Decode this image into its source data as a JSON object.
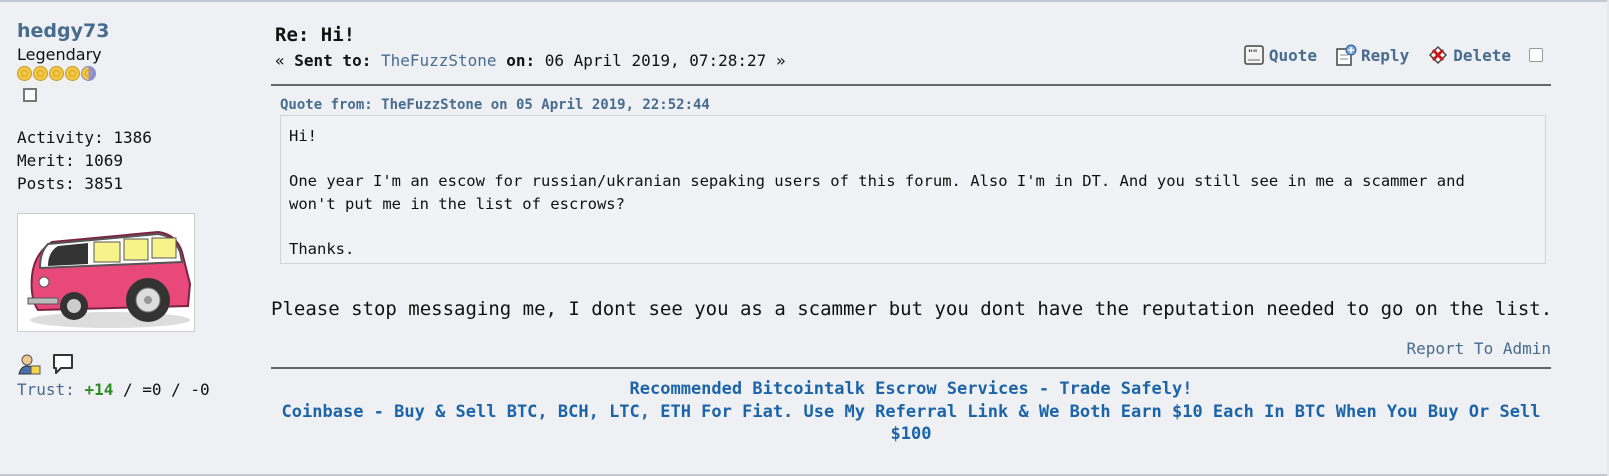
{
  "poster": {
    "username": "hedgy73",
    "rank": "Legendary",
    "stars": [
      "full",
      "full",
      "full",
      "full",
      "half"
    ],
    "activity_label": "Activity: 1386",
    "merit_label": "Merit: 1069",
    "posts_label": "Posts: 3851",
    "trust_label": "Trust:",
    "trust_pos": "+14",
    "trust_rest": " / =0 / -0"
  },
  "post": {
    "subject": "Re: Hi!",
    "sent_prefix": "« ",
    "sent_to_label": "Sent to:",
    "recipient": "TheFuzzStone",
    "on_label": "on:",
    "date": "06 April 2019, 07:28:27",
    "sent_suffix": " »",
    "actions": {
      "quote": "Quote",
      "reply": "Reply",
      "delete": "Delete"
    },
    "quote_header": "Quote from: TheFuzzStone on 05 April 2019, 22:52:44",
    "quote_body": "Hi!\n\nOne year I'm an escow for russian/ukranian sepaking users of this forum. Also I'm in DT. And you still see in me a scammer and\nwon't put me in the list of escrows?\n\nThanks.",
    "reply_text": "Please stop messaging me, I dont see you as a scammer but you dont have the reputation needed to go on the list.",
    "report_link": "Report To Admin"
  },
  "signature": {
    "line1": "Recommended Bitcointalk Escrow Services - Trade Safely!",
    "line2": "Coinbase - Buy & Sell BTC, BCH, LTC, ETH For Fiat. Use My Referral Link & We Both Earn $10 Each In BTC When You Buy Or Sell $100"
  },
  "colors": {
    "link": "#476c8e",
    "signature": "#1c64a8",
    "trust_positive": "#2e8b24"
  }
}
